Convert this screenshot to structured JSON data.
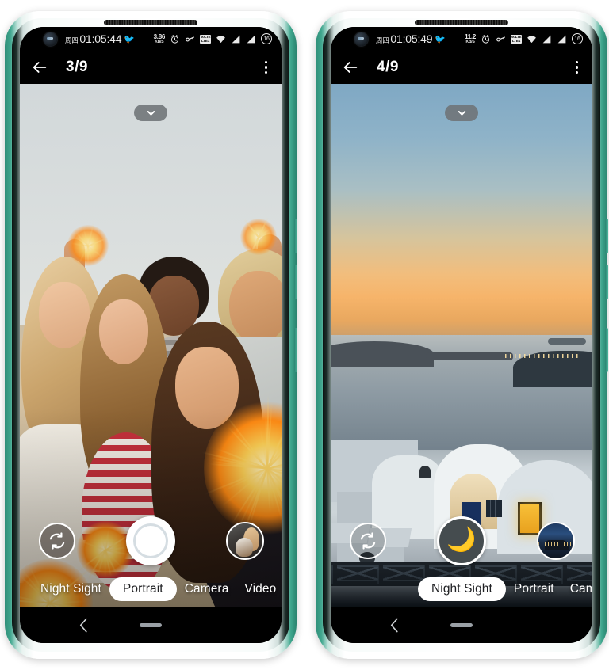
{
  "phones": [
    {
      "id": "phone-left",
      "statusbar": {
        "day": "周四",
        "time": "01:05:44",
        "bird_icon": "bird-icon",
        "net_speed_value": "3.86",
        "net_speed_unit": "KB/S",
        "icons": [
          "alarm-icon",
          "vpn-key-icon",
          "volte-icon",
          "wifi-icon",
          "signal-icon",
          "signal-icon"
        ],
        "volte_top": "VoLTE",
        "volte_bottom": "LTE1",
        "battery": "16"
      },
      "appbar": {
        "back_icon": "back-arrow-icon",
        "title": "3/9",
        "menu_icon": "overflow-menu-icon"
      },
      "viewfinder": {
        "scene": "beach-group-selfie-with-sparklers",
        "expand_icon": "chevron-down-icon"
      },
      "controls": {
        "flip_icon": "camera-flip-icon",
        "shutter_label": "shutter-button",
        "shutter_type": "standard",
        "thumbnail_label": "last-photo-thumbnail",
        "thumbnail_scene": "woman-with-puppy"
      },
      "modes": [
        {
          "label": "Night Sight",
          "active": false
        },
        {
          "label": "Portrait",
          "active": true
        },
        {
          "label": "Camera",
          "active": false
        },
        {
          "label": "Video",
          "active": false
        }
      ],
      "navbar": {
        "back_icon": "nav-back-icon",
        "home_icon": "nav-home-pill"
      }
    },
    {
      "id": "phone-right",
      "statusbar": {
        "day": "周四",
        "time": "01:05:49",
        "bird_icon": "bird-icon",
        "net_speed_value": "11.2",
        "net_speed_unit": "KB/S",
        "icons": [
          "alarm-icon",
          "vpn-key-icon",
          "volte-icon",
          "wifi-icon",
          "signal-icon",
          "signal-icon"
        ],
        "volte_top": "VoLTE",
        "volte_bottom": "LTE1",
        "battery": "16"
      },
      "appbar": {
        "back_icon": "back-arrow-icon",
        "title": "4/9",
        "menu_icon": "overflow-menu-icon"
      },
      "viewfinder": {
        "scene": "santorini-sunset-seaview",
        "expand_icon": "chevron-down-icon"
      },
      "controls": {
        "flip_icon": "camera-flip-icon",
        "shutter_label": "shutter-button",
        "shutter_type": "night",
        "shutter_glyph": "🌙",
        "thumbnail_label": "last-photo-thumbnail",
        "thumbnail_scene": "night-cityscape"
      },
      "modes": [
        {
          "label": "Night Sight",
          "active": true
        },
        {
          "label": "Portrait",
          "active": false
        },
        {
          "label": "Camer",
          "active": false
        }
      ],
      "navbar": {
        "back_icon": "nav-back-icon",
        "home_icon": "nav-home-pill"
      }
    }
  ],
  "colors": {
    "frame": "#2f8d78",
    "accent_white": "#ffffff",
    "statusbar_bg": "#000000",
    "mode_active_bg": "#ffffff",
    "mode_active_text": "#202124",
    "night_shutter_bg": "#454c4f",
    "moon": "#f2e5bd"
  }
}
